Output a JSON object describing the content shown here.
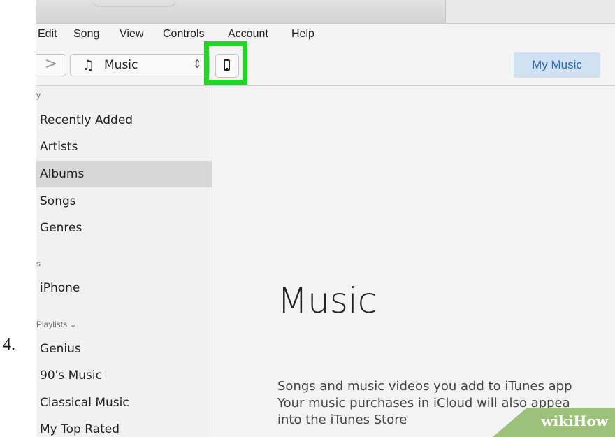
{
  "step_number": "4.",
  "menu": [
    "Edit",
    "Song",
    "View",
    "Controls",
    "Account",
    "Help"
  ],
  "toolbar": {
    "forward_glyph": ">",
    "media_kind": "Music",
    "note_glyph": "♫",
    "updown_glyph": "⇕",
    "my_music_label": "My Music",
    "device_icon": "iphone-icon",
    "highlight_color": "#22d626"
  },
  "sidebar": {
    "library_heading": "y",
    "library_items": [
      "Recently Added",
      "Artists",
      "Albums",
      "Songs",
      "Genres"
    ],
    "selected_item": "Albums",
    "devices_heading": "s",
    "devices": [
      "iPhone"
    ],
    "playlists_heading": "Playlists ⌄",
    "playlists": [
      "Genius",
      "90's Music",
      "Classical Music",
      "My Top Rated"
    ]
  },
  "main": {
    "title": "Music",
    "description_lines": [
      "Songs and music videos you add to iTunes app",
      "Your music purchases in iCloud will also appea",
      "into the iTunes Store"
    ]
  },
  "watermark": "wikiHow"
}
